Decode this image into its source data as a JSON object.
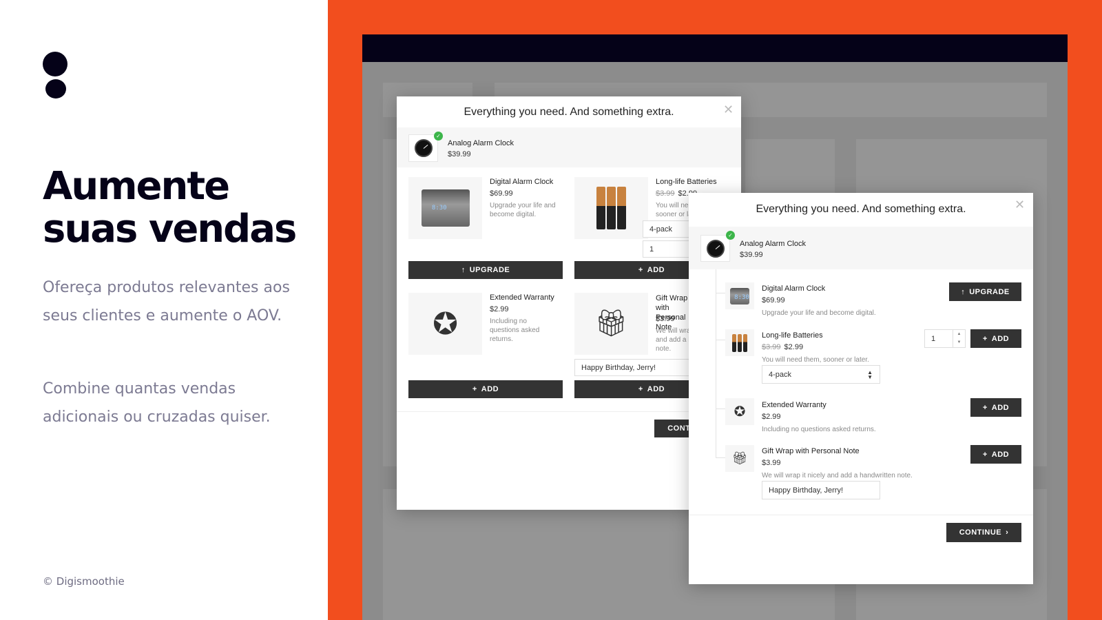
{
  "promo": {
    "headline_line1": "Aumente",
    "headline_line2": "suas vendas",
    "paragraph1": "Ofereça produtos relevantes aos seus clientes e aumente o AOV.",
    "paragraph2": "Combine quantas vendas adicionais ou cruzadas quiser.",
    "copyright": "© Digismoothie"
  },
  "colors": {
    "accent": "#f24e1e",
    "dark": "#050218",
    "button": "#333333",
    "check": "#3cb54a"
  },
  "upsell": {
    "title": "Everything you need. And something extra.",
    "close_icon": "close-icon",
    "cart_item": {
      "name": "Analog Alarm Clock",
      "price": "$39.99"
    },
    "items": [
      {
        "name": "Digital Alarm Clock",
        "price": "$69.99",
        "description": "Upgrade your life and become digital.",
        "button": "UPGRADE",
        "button_icon": "arrow-up-icon"
      },
      {
        "name": "Long-life Batteries",
        "old_price": "$3.99",
        "price": "$2.99",
        "description": "You will need them, sooner or later.",
        "variant": "4-pack",
        "quantity": "1",
        "button": "ADD",
        "button_icon": "plus-icon"
      },
      {
        "name": "Extended Warranty",
        "price": "$2.99",
        "description": "Including no questions asked returns.",
        "button": "ADD",
        "button_icon": "plus-icon"
      },
      {
        "name": "Gift Wrap with Personal Note",
        "price": "$3.99",
        "description": "We will wrap it nicely and add a handwritten note.",
        "note": "Happy Birthday, Jerry!",
        "button": "ADD",
        "button_icon": "plus-icon"
      }
    ],
    "continue": "CONTINUE"
  }
}
